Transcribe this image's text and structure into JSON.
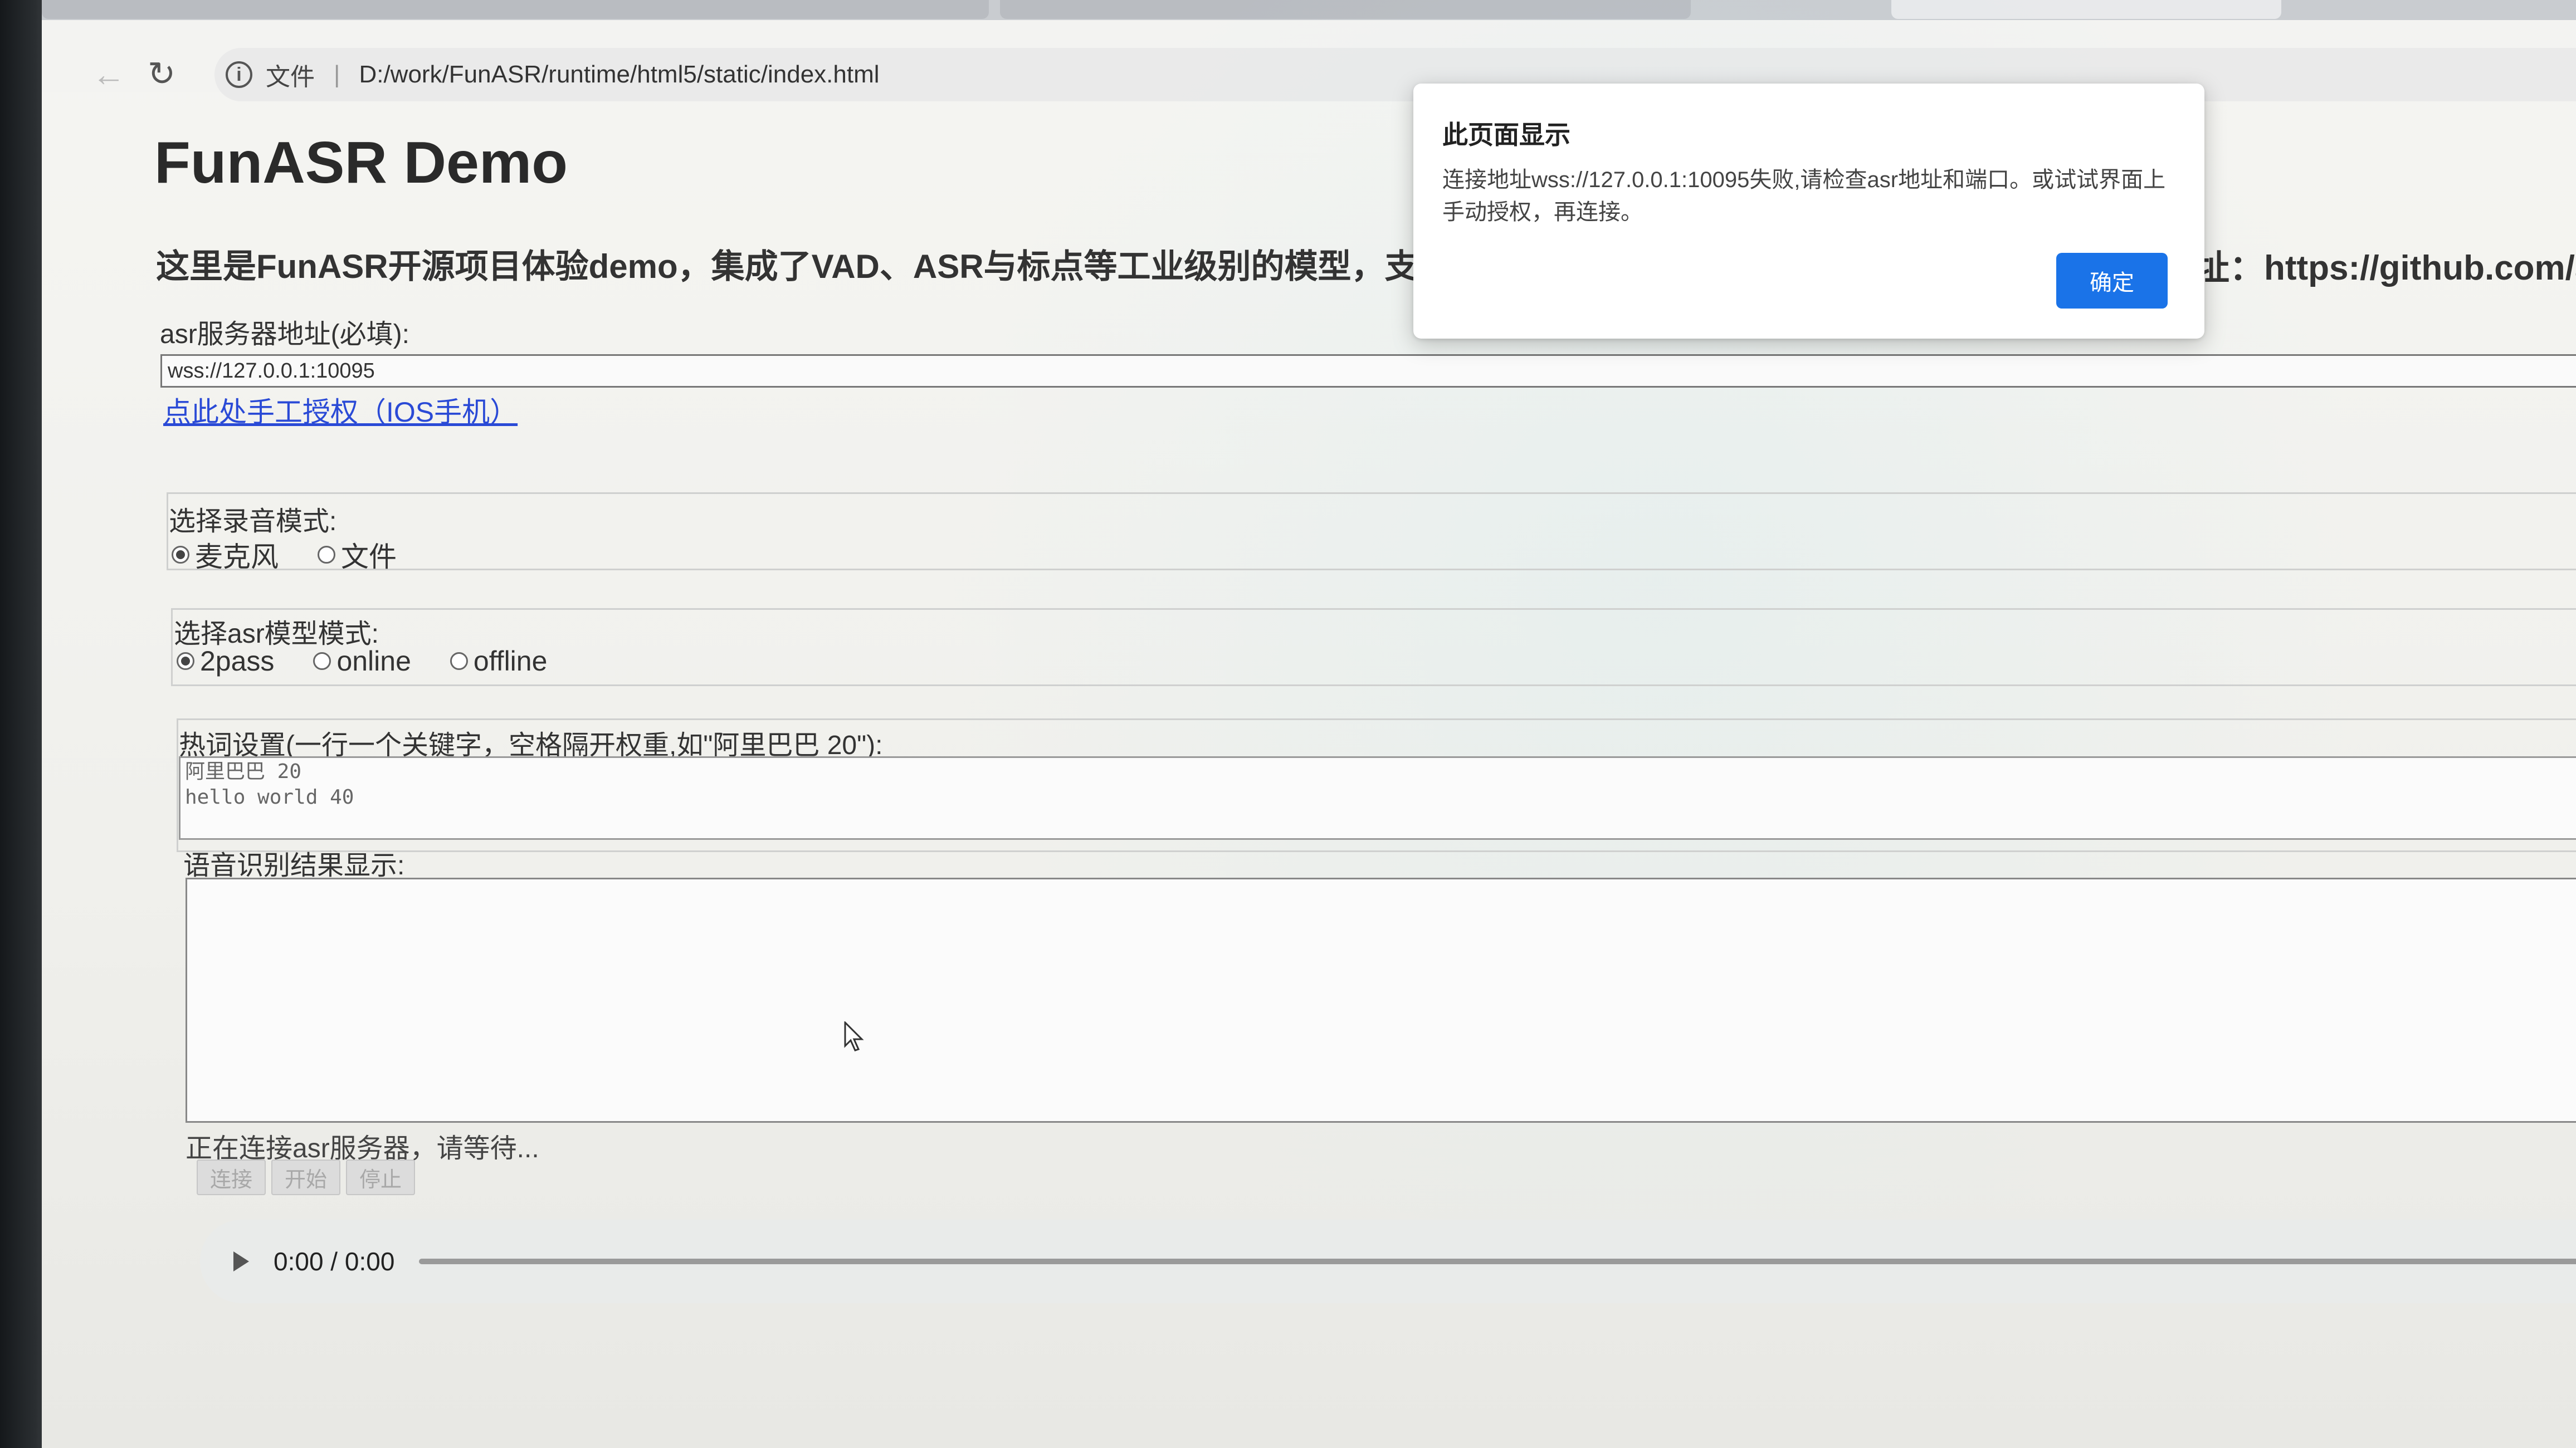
{
  "toolbar": {
    "scheme_label": "文件",
    "separator": "|",
    "url": "D:/work/FunASR/runtime/html5/static/index.html"
  },
  "page": {
    "title": "FunASR Demo",
    "intro_visible_left": "这里是FunASR开源项目体验demo，集成了VAD、ASR与标点等工业级别的模型，支",
    "intro_visible_right": "址：https://github.com/a",
    "asr_label": "asr服务器地址(必填):",
    "asr_value": "wss://127.0.0.1:10095",
    "auth_link": "点此处手工授权（IOS手机）",
    "record_mode": {
      "legend": "选择录音模式:",
      "options": [
        "麦克风",
        "文件"
      ],
      "selected": "麦克风"
    },
    "model_mode": {
      "legend": "选择asr模型模式:",
      "options": [
        "2pass",
        "online",
        "offline"
      ],
      "selected": "2pass"
    },
    "hotwords": {
      "legend": "热词设置(一行一个关键字，空格隔开权重,如\"阿里巴巴 20\"):",
      "value": "阿里巴巴 20\nhello world 40"
    },
    "result_label": "语音识别结果显示:",
    "status_text": "正在连接asr服务器，请等待...",
    "buttons": {
      "connect": "连接",
      "start": "开始",
      "stop": "停止"
    },
    "audio": {
      "time": "0:00 / 0:00"
    }
  },
  "dialog": {
    "title": "此页面显示",
    "message": "连接地址wss://127.0.0.1:10095失败,请检查asr地址和端口。或试试界面上手动授权，再连接。",
    "ok_label": "确定"
  },
  "colors": {
    "link": "#2a4ad6",
    "dialog_button": "#1a73e8"
  }
}
